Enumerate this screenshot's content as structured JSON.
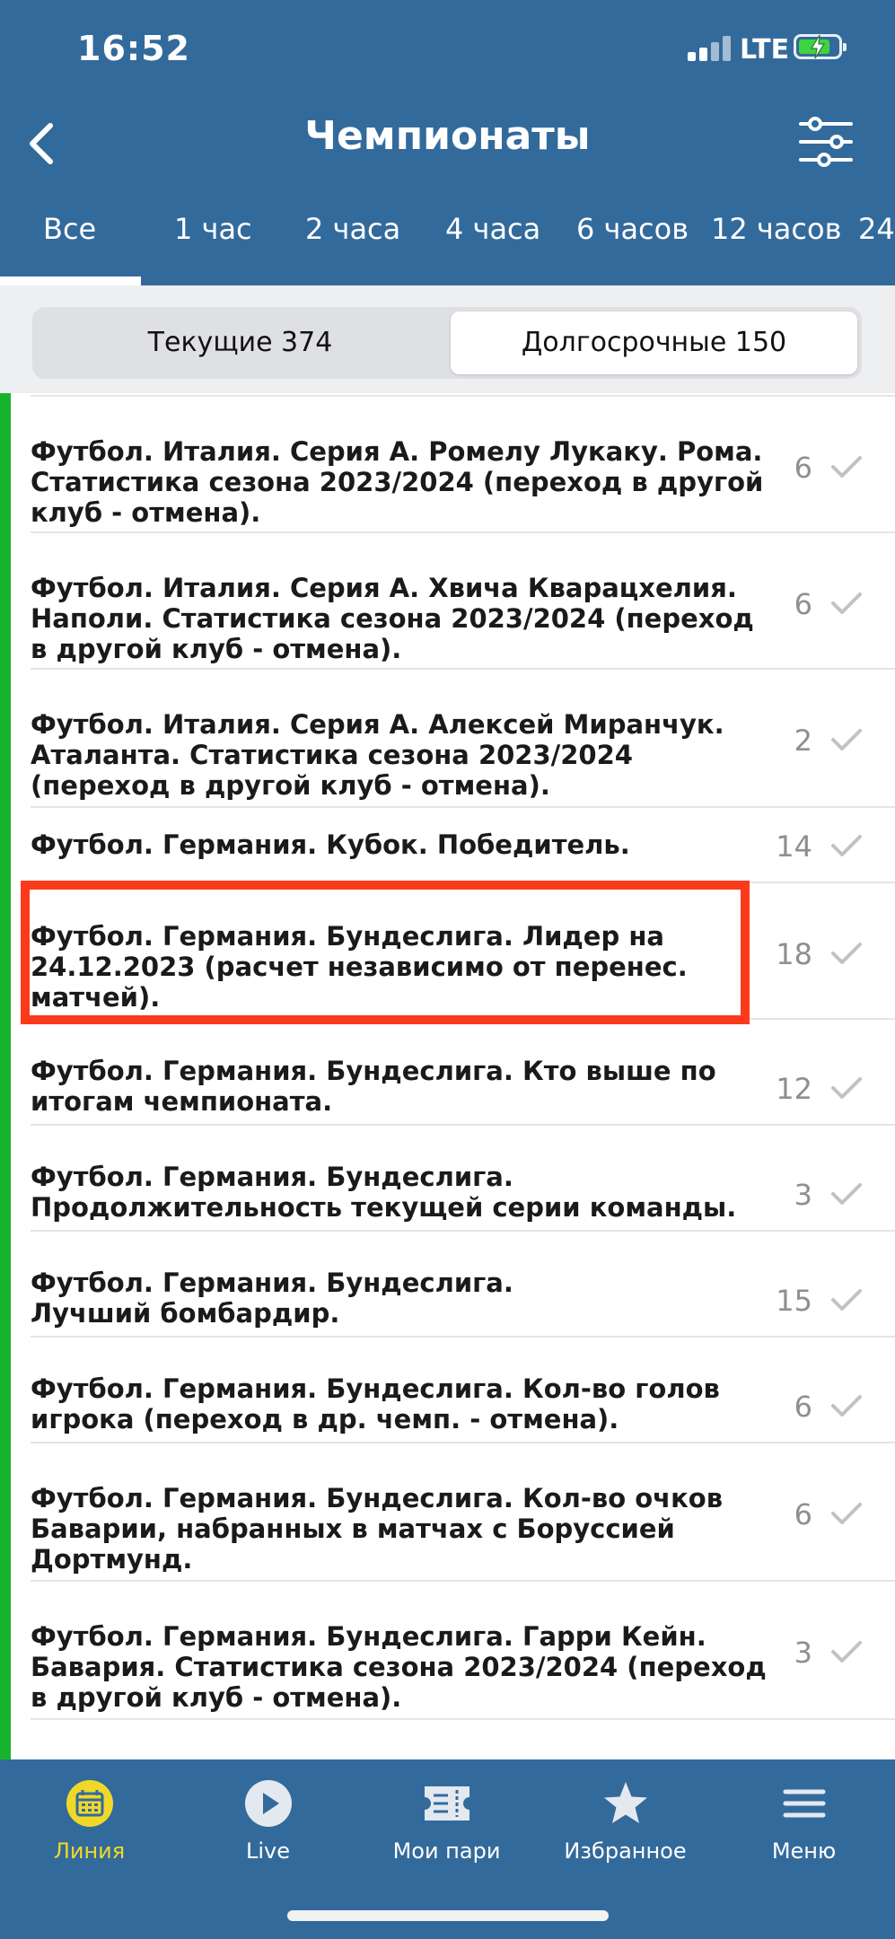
{
  "status": {
    "time": "16:52",
    "network": "LTE"
  },
  "header": {
    "title": "Чемпионаты"
  },
  "time_tabs": [
    "Все",
    "1 час",
    "2 часа",
    "4 часа",
    "6 часов",
    "12 часов",
    "24"
  ],
  "active_tab": "Все",
  "segments": {
    "current": "Текущие 374",
    "long_term": "Долгосрочные 150",
    "selected": "long_term"
  },
  "events": [
    {
      "title": "Футбол. Италия. Серия А. Ромелу Лукаку. Рома. Статистика сезона 2023/2024 (переход в другой клуб - отмена).",
      "count": "6"
    },
    {
      "title": "Футбол. Италия. Серия А. Хвича Кварацхелия. Наполи. Статистика сезона 2023/2024 (переход в другой клуб - отмена).",
      "count": "6"
    },
    {
      "title": "Футбол. Италия. Серия А. Алексей Миранчук. Аталанта. Статистика сезона 2023/2024 (переход в другой клуб - отмена).",
      "count": "2"
    },
    {
      "title": "Футбол. Германия. Кубок. Победитель.",
      "count": "14"
    },
    {
      "title": "Футбол. Германия. Бундеслига. Лидер на 24.12.2023 (расчет независимо от перенес. матчей).",
      "count": "18"
    },
    {
      "title": "Футбол. Германия. Бундеслига. Кто выше по итогам чемпионата.",
      "count": "12"
    },
    {
      "title": "Футбол. Германия. Бундеслига. Продолжительность текущей серии команды.",
      "count": "3"
    },
    {
      "title": "Футбол. Германия. Бундеслига. Лучший бомбардир.",
      "count": "15"
    },
    {
      "title": "Футбол. Германия. Бундеслига. Кол-во голов игрока (переход в др. чемп. - отмена).",
      "count": "6"
    },
    {
      "title": "Футбол. Германия. Бундеслига. Кол-во очков Баварии, набранных в матчах с Боруссией Дортмунд.",
      "count": "6"
    },
    {
      "title": "Футбол. Германия. Бундеслига. Гарри Кейн. Бавария. Статистика сезона 2023/2024 (переход в другой клуб - отмена).",
      "count": "3"
    }
  ],
  "highlighted_event_index": 4,
  "bottom_nav": [
    {
      "label": "Линия",
      "icon": "calendar-icon",
      "active": true
    },
    {
      "label": "Live",
      "icon": "play-icon",
      "active": false
    },
    {
      "label": "Мои пари",
      "icon": "ticket-icon",
      "active": false
    },
    {
      "label": "Избранное",
      "icon": "star-icon",
      "active": false
    },
    {
      "label": "Меню",
      "icon": "menu-icon",
      "active": false
    }
  ],
  "colors": {
    "header": "#336a9c",
    "accent_active": "#f0d829",
    "live_bar": "#16b42c",
    "highlight_box": "#fb3a1c"
  }
}
